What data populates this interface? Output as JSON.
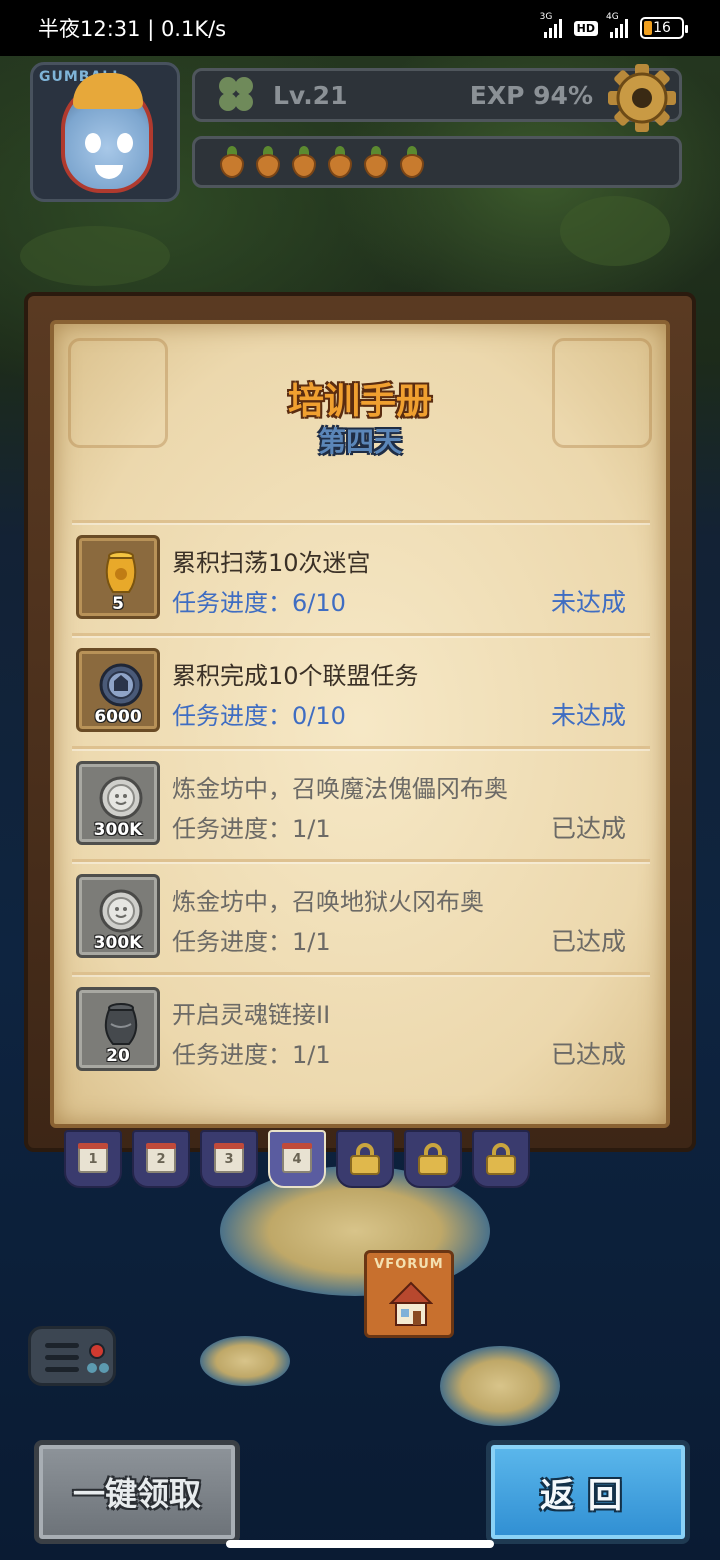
{
  "status_bar": {
    "time": "半夜12:31 | 0.1K/s",
    "network_1": "3G",
    "hd": "HD",
    "network_2": "4G",
    "battery": "16"
  },
  "hud": {
    "avatar_tag": "GUMBALL",
    "level": "Lv.21",
    "exp": "EXP 94%",
    "carrot_count": 6
  },
  "panel": {
    "title": "培训手册",
    "subtitle": "第四天",
    "tasks": [
      {
        "icon": "golden-vase-icon",
        "quantity": "5",
        "name": "累积扫荡10次迷宫",
        "progress": "任务进度：6/10",
        "status": "未达成",
        "done": false
      },
      {
        "icon": "alliance-coin-icon",
        "quantity": "6000",
        "name": "累积完成10个联盟任务",
        "progress": "任务进度：0/10",
        "status": "未达成",
        "done": false
      },
      {
        "icon": "silver-coin-icon",
        "quantity": "300K",
        "name": "炼金坊中，召唤魔法傀儡冈布奥",
        "progress": "任务进度：1/1",
        "status": "已达成",
        "done": true
      },
      {
        "icon": "silver-coin-icon",
        "quantity": "300K",
        "name": "炼金坊中，召唤地狱火冈布奥",
        "progress": "任务进度：1/1",
        "status": "已达成",
        "done": true
      },
      {
        "icon": "dark-vase-icon",
        "quantity": "20",
        "name": "开启灵魂链接II",
        "progress": "任务进度：1/1",
        "status": "已达成",
        "done": true
      }
    ]
  },
  "day_tabs": [
    {
      "label": "1",
      "locked": false,
      "active": false
    },
    {
      "label": "2",
      "locked": false,
      "active": false
    },
    {
      "label": "3",
      "locked": false,
      "active": false
    },
    {
      "label": "4",
      "locked": false,
      "active": true
    },
    {
      "label": "",
      "locked": true,
      "active": false
    },
    {
      "label": "",
      "locked": true,
      "active": false
    },
    {
      "label": "",
      "locked": true,
      "active": false
    }
  ],
  "map": {
    "forum_label": "VFORUM"
  },
  "buttons": {
    "claim_all": "一键领取",
    "back": "返回"
  },
  "colors": {
    "progress_incomplete": "#3f6dc2",
    "progress_complete": "#6c6a66",
    "title_orange": "#f0a030",
    "subtitle_blue": "#5b86b8",
    "back_button_blue": "#2f8ed2"
  }
}
